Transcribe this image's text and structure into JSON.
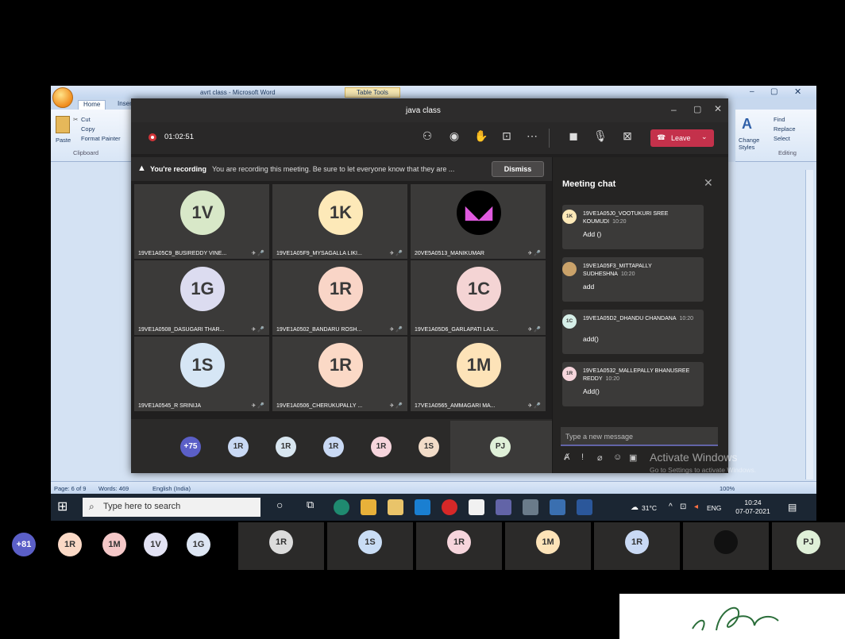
{
  "word": {
    "title": "avrt class - Microsoft Word",
    "table_tools": "Table Tools",
    "tabs": [
      "Home",
      "Insert"
    ],
    "clipboard": {
      "cut": "Cut",
      "copy": "Copy",
      "paste": "Paste",
      "format_painter": "Format Painter",
      "group": "Clipboard"
    },
    "editing": {
      "find": "Find",
      "replace": "Replace",
      "select": "Select",
      "change_styles": "Change Styles",
      "group": "Editing"
    },
    "status": {
      "page": "Page: 6 of 9",
      "words": "Words: 469",
      "language": "English (India)",
      "zoom": "100%"
    }
  },
  "taskbar": {
    "search_placeholder": "Type here to search",
    "weather": "31°C",
    "language": "ENG",
    "time": "10:24",
    "date": "07-07-2021"
  },
  "activation": {
    "title": "Activate Windows",
    "subtitle": "Go to Settings to activate Windows."
  },
  "teams": {
    "title": "java class",
    "timer": "01:02:51",
    "leave_label": "Leave",
    "banner": {
      "bold": "You're recording",
      "text": "You are recording this meeting. Be sure to let everyone know that they are ...",
      "dismiss": "Dismiss"
    },
    "tiles": [
      {
        "initials": "1V",
        "name": "19VE1A05C9_BUSIREDDY VINE...",
        "color": "#d8e8c8"
      },
      {
        "initials": "1K",
        "name": "19VE1A05F9_MYSAGALLA LIKI...",
        "color": "#fde9b8"
      },
      {
        "initials": "",
        "name": "20VE5A0513_MANIKUMAR",
        "color": "#000000"
      },
      {
        "initials": "1G",
        "name": "19VE1A0508_DASUGARI THAR...",
        "color": "#dcdcf0"
      },
      {
        "initials": "1R",
        "name": "19VE1A0502_BANDARU ROSH...",
        "color": "#f9d5c7"
      },
      {
        "initials": "1C",
        "name": "19VE1A05D6_GARLAPATI LAX...",
        "color": "#f4d4d4"
      },
      {
        "initials": "1S",
        "name": "19VE1A0545_R SRINIJA",
        "color": "#d6e6f5"
      },
      {
        "initials": "1R",
        "name": "19VE1A0506_CHERUKUPALLY ...",
        "color": "#fbd9c6"
      },
      {
        "initials": "1M",
        "name": "17VE1A0565_AMMAGARI MA...",
        "color": "#fde3b8"
      }
    ],
    "strip": [
      {
        "initials": "+75",
        "color": "#5b5fc7"
      },
      {
        "initials": "1R",
        "color": "#c9d9f4"
      },
      {
        "initials": "1R",
        "color": "#d8e6f0"
      },
      {
        "initials": "1R",
        "color": "#c9d9f4"
      },
      {
        "initials": "1R",
        "color": "#f6d5dc"
      },
      {
        "initials": "1S",
        "color": "#f2dcc8"
      }
    ],
    "strip_self": {
      "initials": "PJ",
      "color": "#dff0d8"
    },
    "chat": {
      "title": "Meeting chat",
      "placeholder": "Type a new message",
      "messages": [
        {
          "avatar": "1K",
          "color": "#fde9b8",
          "sender": "19VE1A05J0_VOOTUKURI SREE KOUMUDI",
          "time": "10:20",
          "text": "Add ()"
        },
        {
          "avatar": "",
          "color": "#caa26a",
          "sender": "19VE1A05F3_MITTAPALLY SUDHESHNA",
          "time": "10:20",
          "text": "add"
        },
        {
          "avatar": "1C",
          "color": "#d6efe8",
          "sender": "19VE1A05D2_DHANDU CHANDANA",
          "time": "10:20",
          "text": "add()"
        },
        {
          "avatar": "1R",
          "color": "#f6d5dc",
          "sender": "19VE1A0532_MALLEPALLY BHANUSREE REDDY",
          "time": "10:20",
          "text": "Add()"
        }
      ]
    }
  },
  "outer": {
    "left": [
      {
        "initials": "+81",
        "color": "#5b5fc7"
      },
      {
        "initials": "1R",
        "color": "#fbd9c6"
      },
      {
        "initials": "1M",
        "color": "#f5c8c8"
      },
      {
        "initials": "1V",
        "color": "#e2e2f3"
      },
      {
        "initials": "1G",
        "color": "#dde6f3"
      }
    ],
    "tiles": [
      {
        "initials": "1R",
        "color": "#dcdcdc"
      },
      {
        "initials": "1S",
        "color": "#c9ddf5"
      },
      {
        "initials": "1R",
        "color": "#f6d5dc"
      },
      {
        "initials": "1M",
        "color": "#fde3b8"
      },
      {
        "initials": "1R",
        "color": "#c9d9f4"
      },
      {
        "initials": "",
        "color": "#111111"
      },
      {
        "initials": "PJ",
        "color": "#dff0d8"
      }
    ]
  },
  "colors": {
    "accent": "#6264a7",
    "leave": "#c4314b",
    "recording": "#d13438"
  }
}
